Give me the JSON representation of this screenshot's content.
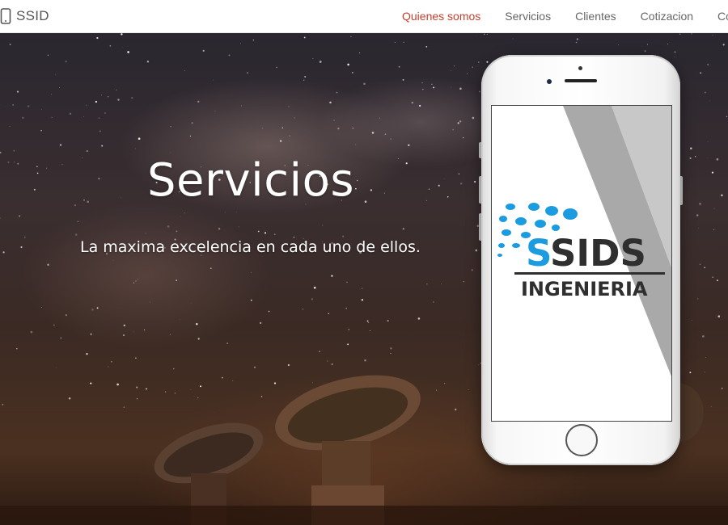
{
  "navbar": {
    "brand": "SSID",
    "brand_icon": "mobile-phone-icon",
    "items": [
      {
        "label": "Quienes somos",
        "active": true
      },
      {
        "label": "Servicios",
        "active": false
      },
      {
        "label": "Clientes",
        "active": false
      },
      {
        "label": "Cotizacion",
        "active": false
      },
      {
        "label": "Contacto",
        "active": false
      }
    ]
  },
  "hero": {
    "title": "Servicios",
    "subtitle": "La maxima excelencia en cada uno de ellos."
  },
  "phone": {
    "logo": {
      "brand": "SSIDS",
      "tagline": "INGENIERIA"
    }
  },
  "colors": {
    "nav_active": "#c6402f",
    "nav_text": "#666666",
    "logo_blue": "#1b9be0",
    "logo_dark": "#2f2f2f"
  }
}
